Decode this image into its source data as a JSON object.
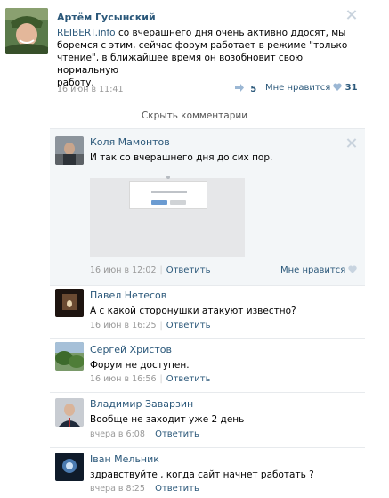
{
  "post": {
    "author": "Артём Гусынский",
    "text_link": "REIBERT.info",
    "text_lines": [
      " со вчерашнего дня очень активно ддосят, мы",
      "боремся с этим, сейчас форум работает в режиме \"только",
      "чтение\", в ближайшее время он возобновит свою нормальную",
      "работу."
    ],
    "date": "16 июн в 11:41",
    "shares": "5",
    "like_label": "Мне нравится",
    "like_count": "31"
  },
  "hide_comments": "Скрыть комментарии",
  "comments": [
    {
      "author": "Коля Мамонтов",
      "text": "И так со вчерашнего дня до сих пор.",
      "date": "16 июн в 12:02",
      "reply": "Ответить",
      "like_label": "Мне нравится"
    },
    {
      "author": "Павел Нетесов",
      "text": "А с какой сторонушки атакуют известно?",
      "date": "16 июн в 16:25",
      "reply": "Ответить"
    },
    {
      "author": "Сергей Христов",
      "text": "Форум не доступен.",
      "date": "16 июн в 16:56",
      "reply": "Ответить"
    },
    {
      "author": "Владимир Заварзин",
      "text": "Вообще не заходит уже 2 день",
      "date": "вчера в 6:08",
      "reply": "Ответить"
    },
    {
      "author": "Іван Мельник",
      "text": "здравствуйте , когда сайт начнет работать ?",
      "date": "вчера в 8:25",
      "reply": "Ответить"
    }
  ],
  "colors": {
    "link": "#2b587a",
    "meta": "#999999",
    "highlight": "#f3f6f8",
    "heart": "#9bb7d4"
  },
  "icons": [
    "close-icon",
    "share-icon",
    "heart-icon"
  ]
}
